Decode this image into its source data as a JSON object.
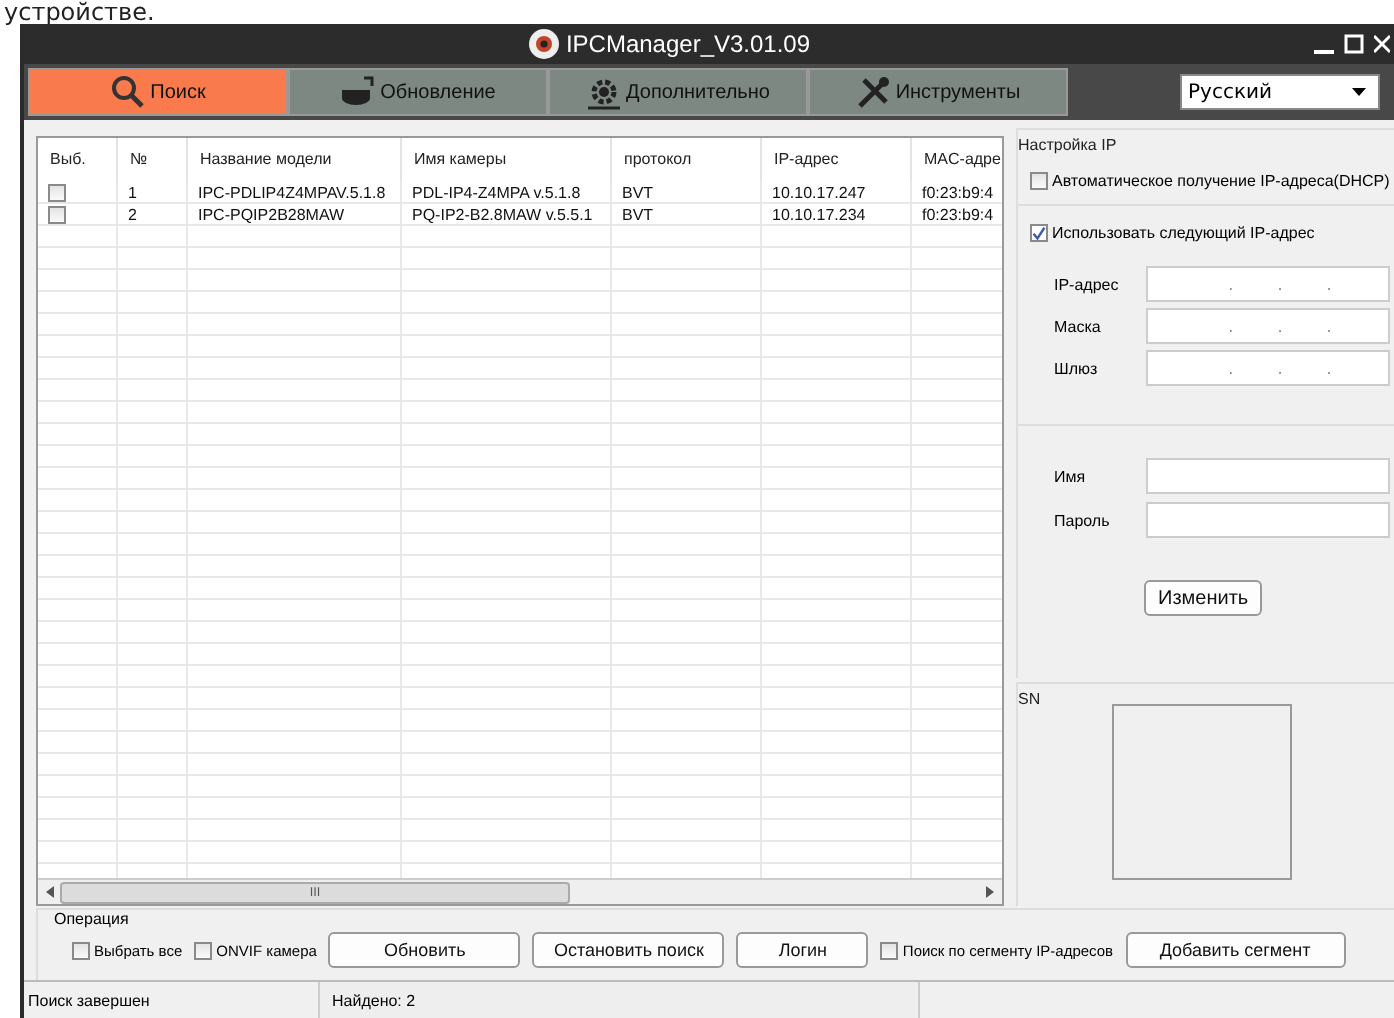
{
  "page_text": "устройстве.",
  "window": {
    "title": "IPCManager_V3.01.09"
  },
  "tabs": [
    {
      "label": "Поиск",
      "selected": true
    },
    {
      "label": "Обновление",
      "selected": false
    },
    {
      "label": "Дополнительно",
      "selected": false
    },
    {
      "label": "Инструменты",
      "selected": false
    }
  ],
  "language": {
    "value": "Русский"
  },
  "table": {
    "select_header": "Выб.",
    "columns": [
      "№",
      "Название модели",
      "Имя камеры",
      "протокол",
      "IP-адрес",
      "MAC-адре"
    ],
    "rows": [
      {
        "checked": false,
        "cells": [
          "1",
          "IPC-PDLIP4Z4MPAV.5.1.8",
          "PDL-IP4-Z4MPA v.5.1.8",
          "BVT",
          "10.10.17.247",
          "f0:23:b9:4"
        ]
      },
      {
        "checked": false,
        "cells": [
          "2",
          "IPC-PQIP2B28MAW",
          "PQ-IP2-B2.8MAW v.5.5.1",
          "BVT",
          "10.10.17.234",
          "f0:23:b9:4"
        ]
      }
    ],
    "scrollbar_grip": "III"
  },
  "ip_settings": {
    "title": "Настройка IP",
    "options": [
      {
        "label": "Автоматическое получение IP-адреса(DHCP)",
        "checked": false
      },
      {
        "label": "Использовать следующий IP-адрес",
        "checked": true
      }
    ],
    "address_fields": [
      {
        "label": "IP-адрес",
        "separators": [
          ".",
          ".",
          "."
        ]
      },
      {
        "label": "Маска",
        "separators": [
          ".",
          ".",
          "."
        ]
      },
      {
        "label": "Шлюз",
        "separators": [
          ".",
          ".",
          "."
        ]
      }
    ],
    "credential_fields": [
      {
        "label": "Имя"
      },
      {
        "label": "Пароль"
      }
    ],
    "button": "Изменить"
  },
  "sn": {
    "title": "SN"
  },
  "operation": {
    "title": "Операция",
    "controls": [
      {
        "kind": "checkbox",
        "label": "Выбрать все",
        "checked": false
      },
      {
        "kind": "checkbox",
        "label": "ONVIF камера",
        "checked": false
      },
      {
        "kind": "button",
        "label": "Обновить"
      },
      {
        "kind": "button",
        "label": "Остановить поиск"
      },
      {
        "kind": "button",
        "label": "Логин"
      },
      {
        "kind": "checkbox",
        "label": "Поиск по сегменту IP-адресов",
        "checked": false
      },
      {
        "kind": "button",
        "label": "Добавить сегмент"
      }
    ]
  },
  "status_bar": [
    "Поиск завершен",
    "Найдено: 2"
  ]
}
